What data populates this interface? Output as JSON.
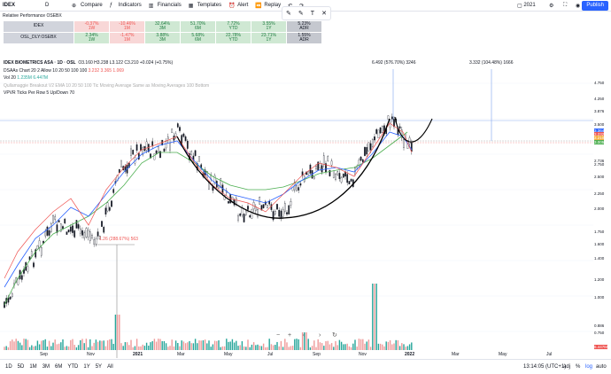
{
  "topbar": {
    "symbol": "IDEX",
    "interval": "D",
    "compare": "Compare",
    "indicators": "Indicators",
    "financials": "Financials",
    "templates": "Templates",
    "alert": "Alert",
    "replay": "Replay",
    "layout_year": "2021",
    "publish": "Publish"
  },
  "perf": {
    "title": "Relative Performance OSEBX",
    "rows": [
      {
        "name": "IDEX",
        "cells": [
          [
            "-0.37%",
            "1W"
          ],
          [
            "-10.46%",
            "1M"
          ],
          [
            "32.64%",
            "3M"
          ],
          [
            "51.70%",
            "6M"
          ],
          [
            "7.72%",
            "YTD"
          ],
          [
            "3.55%",
            "1Y"
          ],
          [
            "5.23%",
            "ADR"
          ]
        ]
      },
      {
        "name": "OSL_DLY:OSEBX",
        "cells": [
          [
            "2.34%",
            "1W"
          ],
          [
            "-1.47%",
            "1M"
          ],
          [
            "3.88%",
            "3M"
          ],
          [
            "5.68%",
            "6M"
          ],
          [
            "22.78%",
            "YTD"
          ],
          [
            "23.71%",
            "1Y"
          ],
          [
            "1.55%",
            "ADR"
          ]
        ]
      }
    ]
  },
  "legend": {
    "l1": "IDEX BIOMETRICS ASA · 1D · OSL",
    "l1b": "O3.160 H3.238 L3.122 C3.210 +0.024 (+0.75%)",
    "l2": "DSAAs Chart 20 2 Allow 10 20 50 100 100",
    "l2b": "3.232 3.365 1.069",
    "l3": "Vol 20",
    "l3b": "1.235M 6.447M",
    "l4": "Qullamaggie Breakout V2 EMA 10 20 50 100 Tic Moving Average Same as Moving Averages 100 Bottom",
    "l5": "VPVR Ticks Per Row 5 Up/Down 70"
  },
  "annotations": {
    "a1": "6.492 (576.70%) 3246",
    "a2": "3.332 (104.48%) 1666",
    "a3": "1.26 (288.67%) 563"
  },
  "price_labels": [
    "4.750",
    "4.250",
    "3.876",
    "3.500",
    "3.364",
    "3.232",
    "3.210",
    "3.005",
    "2.736",
    "2.750",
    "2.500",
    "2.250",
    "2.000",
    "1.750",
    "1.600",
    "1.400",
    "1.200",
    "1.000",
    "0.886",
    "0.750",
    "6.447M"
  ],
  "time_labels": [
    "Sep",
    "Nov",
    "2021",
    "Mar",
    "May",
    "Jul",
    "Sep",
    "Nov",
    "2022",
    "Mar",
    "May",
    "Jul"
  ],
  "bottom": {
    "ranges": [
      "1D",
      "5D",
      "1M",
      "3M",
      "6M",
      "YTD",
      "1Y",
      "5Y",
      "All"
    ],
    "clock": "13:14:05 (UTC+1)",
    "adj": "adj",
    "pct": "%",
    "log": "log",
    "auto": "auto"
  },
  "colors": {
    "accent": "#2962ff",
    "up": "#26a69a",
    "down": "#ef5350",
    "cup": "#000000"
  }
}
